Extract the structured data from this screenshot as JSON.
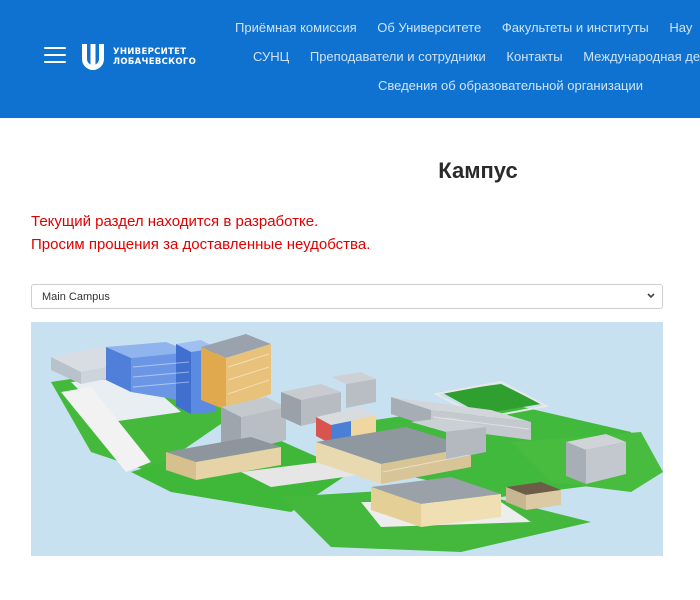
{
  "header": {
    "logo_line1": "УНИВЕРСИТЕТ",
    "logo_line2": "ЛОБАЧЕВСКОГО",
    "nav_row1": [
      "Приёмная комиссия",
      "Об Университете",
      "Факультеты и институты",
      "Нау"
    ],
    "nav_row2": [
      "СУНЦ",
      "Преподаватели и сотрудники",
      "Контакты",
      "Международная дея"
    ],
    "nav_row3": [
      "Сведения об образовательной организации"
    ]
  },
  "main": {
    "title": "Кампус",
    "notice_line1": "Текущий раздел находится в разработке.",
    "notice_line2": "Просим прощения за доставленные неудобства.",
    "campus_select": "Main Campus"
  },
  "colors": {
    "header_bg": "#0f72d1",
    "notice": "#e00000",
    "map_sky": "#c8e1f0",
    "grass": "#3fb83a"
  },
  "icons": [
    "menu-icon",
    "university-logo-icon",
    "chevron-down-icon"
  ]
}
